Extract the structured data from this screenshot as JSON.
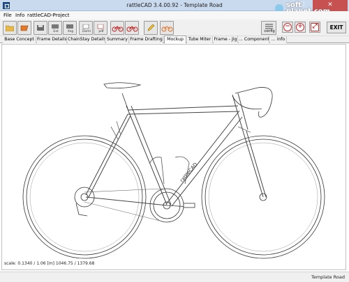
{
  "window": {
    "title": "rattleCAD  3.4.00.92 - Template Road",
    "close_glyph": "✕",
    "min_glyph": "—",
    "max_glyph": "☐"
  },
  "menu": {
    "items": [
      "File",
      "Info",
      "rattleCAD-Project"
    ]
  },
  "toolbar": {
    "buttons": [
      "",
      "",
      "Ext",
      "Xsg",
      "Dxml",
      "pdf",
      "",
      "",
      "",
      ""
    ],
    "config_label": "config",
    "zoom_out": "−",
    "zoom_in": "+",
    "fit": "⤢",
    "exit_label": "EXIT"
  },
  "tabs": [
    "Base Concept",
    "Frame Details",
    "ChainStay Details",
    "Summary",
    "Frame Drafting",
    "Mockup",
    "Tube Miter",
    "Frame - Jig",
    "... Components",
    "... info"
  ],
  "active_tab": "Mockup",
  "canvas": {
    "scale": "scale: 0.1340 / 1.06  [m]  1046.75 / 1379.68",
    "frame_decal": "rattleCAD"
  },
  "status": {
    "text": "Template Road"
  },
  "watermark": {
    "line1": "soft",
    "line2": "planet.com"
  }
}
